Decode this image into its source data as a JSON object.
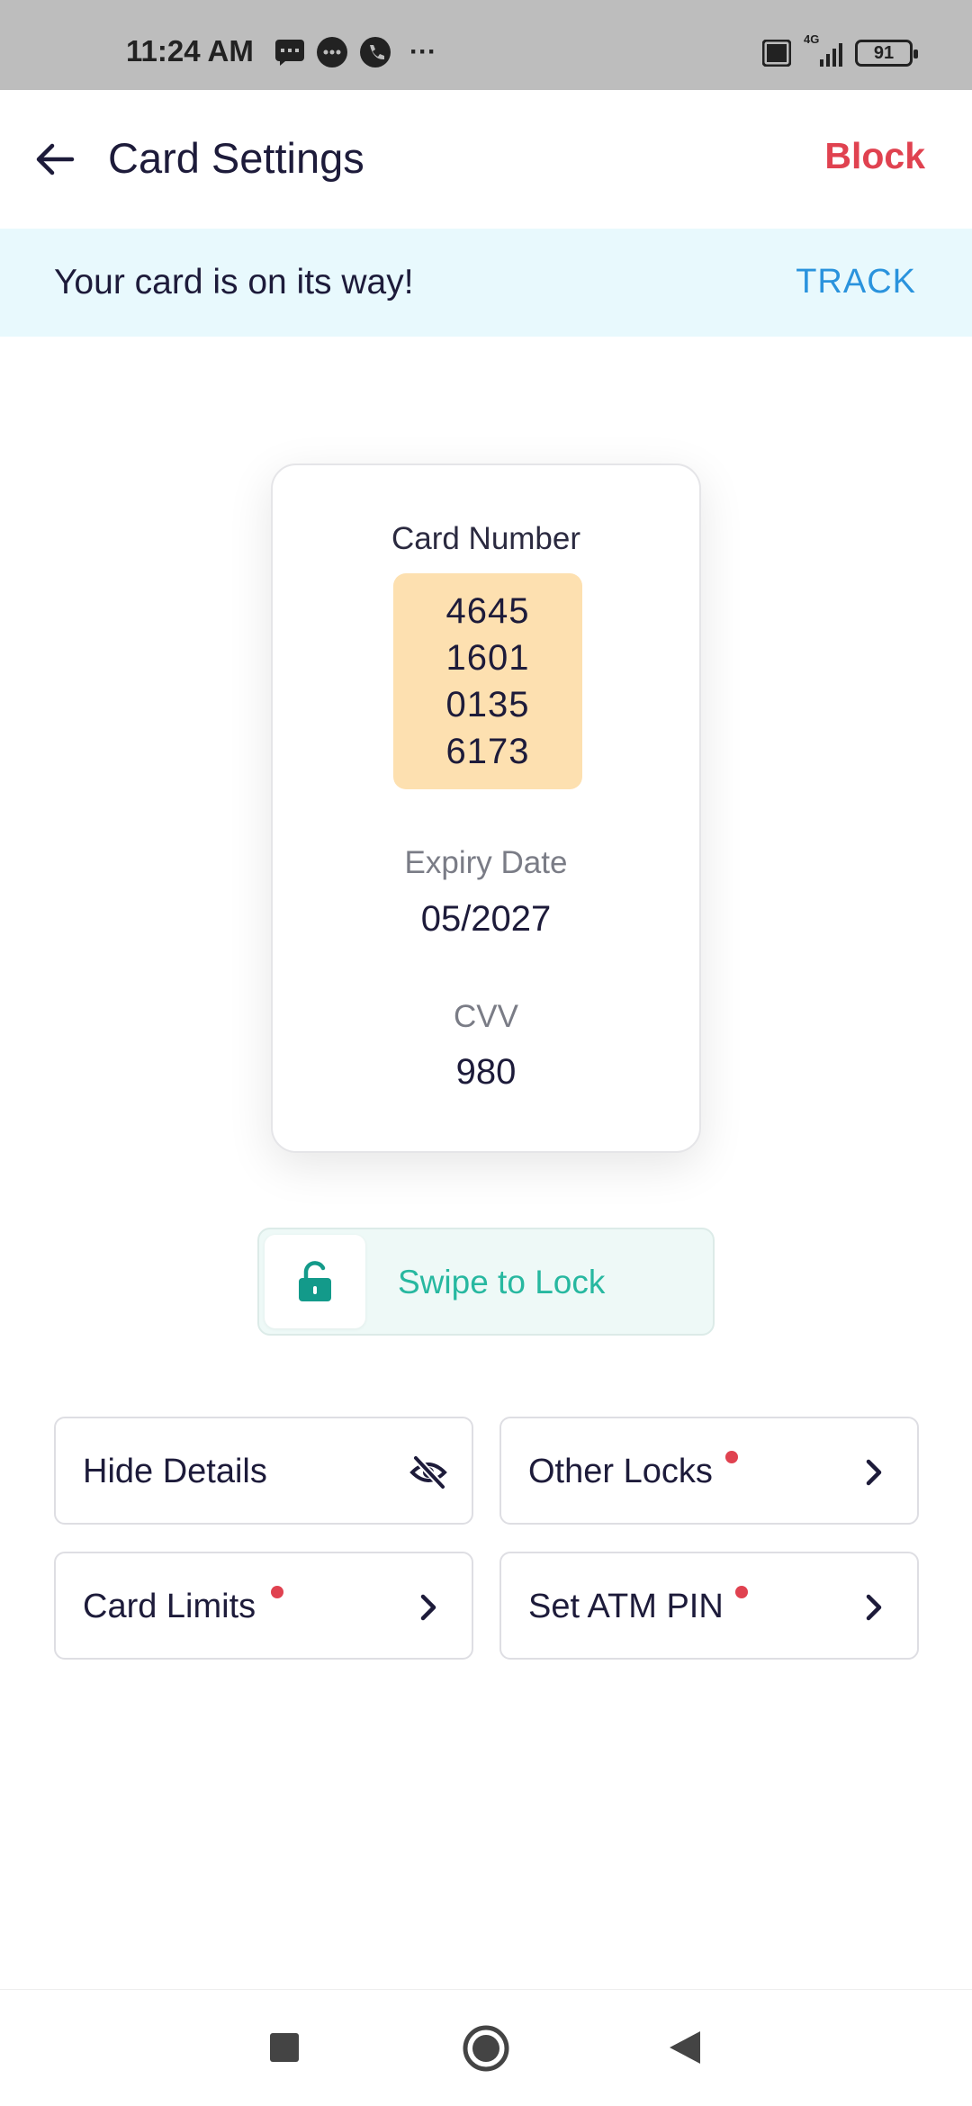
{
  "status_bar": {
    "time": "11:24 AM",
    "more": "···",
    "network": "4G",
    "battery": "91"
  },
  "header": {
    "title": "Card Settings",
    "block_label": "Block"
  },
  "banner": {
    "message": "Your card is on its way!",
    "action_label": "TRACK"
  },
  "card": {
    "number_label": "Card Number",
    "number_groups": [
      "4645",
      "1601",
      "0135",
      "6173"
    ],
    "expiry_label": "Expiry Date",
    "expiry_value": "05/2027",
    "cvv_label": "CVV",
    "cvv_value": "980"
  },
  "swipe_lock": {
    "label": "Swipe to Lock"
  },
  "options": [
    {
      "label": "Hide Details",
      "icon": "eye-off-icon",
      "has_dot": false
    },
    {
      "label": "Other Locks",
      "icon": "chevron-right-icon",
      "has_dot": true
    },
    {
      "label": "Card Limits",
      "icon": "chevron-right-icon",
      "has_dot": true
    },
    {
      "label": "Set ATM PIN",
      "icon": "chevron-right-icon",
      "has_dot": true
    }
  ],
  "colors": {
    "accent_red": "#e04250",
    "link_blue": "#2a93dd",
    "teal": "#27b8a0",
    "banner_bg": "#e8f9fd",
    "number_bg": "#fde0b0"
  }
}
